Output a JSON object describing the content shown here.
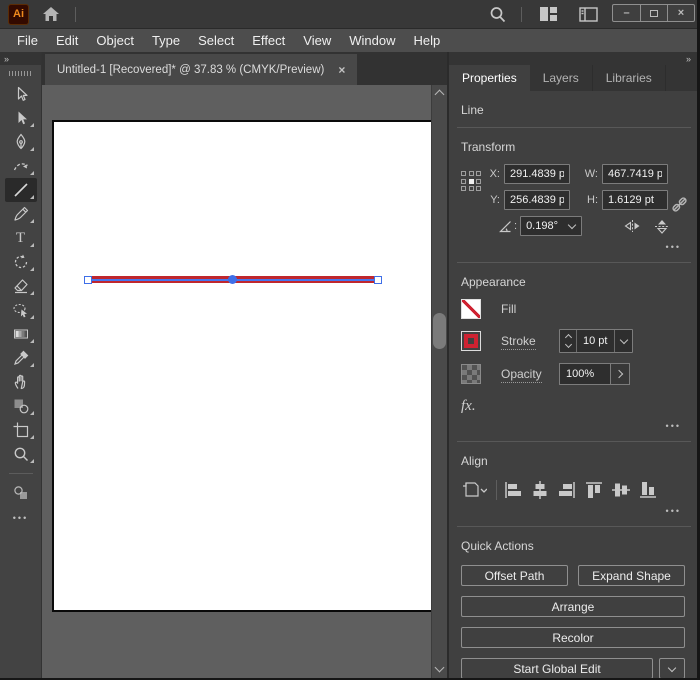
{
  "titlebar": {
    "logo": "Ai",
    "controls": {
      "minimize": "–",
      "close": "×"
    }
  },
  "menubar": {
    "items": [
      "File",
      "Edit",
      "Object",
      "Type",
      "Select",
      "Effect",
      "View",
      "Window",
      "Help"
    ]
  },
  "document_tab": {
    "title": "Untitled-1 [Recovered]* @ 37.83 % (CMYK/Preview)",
    "close_glyph": "×"
  },
  "glyphs": {
    "collapse": "»",
    "more": "•••"
  },
  "toolbar": {
    "tools": [
      "selection",
      "direct-selection",
      "pen",
      "curvature",
      "line-segment",
      "paintbrush",
      "type",
      "rotate",
      "eraser",
      "shape-builder",
      "gradient",
      "eyedropper",
      "hand",
      "shapes",
      "artboard",
      "zoom",
      "fill-stroke-proxy",
      "edit-toolbar"
    ],
    "selected_tool": "line-segment",
    "type_tool_glyph": "T"
  },
  "properties_panel": {
    "tabs": {
      "properties": "Properties",
      "layers": "Layers",
      "libraries": "Libraries"
    },
    "active_tab": "Properties",
    "selection_type": "Line",
    "transform": {
      "heading": "Transform",
      "x_label": "X:",
      "x_value": "291.4839 p",
      "y_label": "Y:",
      "y_value": "256.4839 p",
      "w_label": "W:",
      "w_value": "467.7419 p",
      "h_label": "H:",
      "h_value": "1.6129 pt",
      "angle_value": "0.198°"
    },
    "appearance": {
      "heading": "Appearance",
      "fill_label": "Fill",
      "stroke_label": "Stroke",
      "stroke_weight": "10 pt",
      "opacity_label": "Opacity",
      "opacity_value": "100%",
      "fx_label": "fx."
    },
    "align": {
      "heading": "Align"
    },
    "quick_actions": {
      "heading": "Quick Actions",
      "offset_path": "Offset Path",
      "expand_shape": "Expand Shape",
      "arrange": "Arrange",
      "recolor": "Recolor",
      "start_global_edit": "Start Global Edit"
    }
  },
  "colors": {
    "stroke_red": "#c0272e",
    "selection_blue": "#3f6fe8",
    "panel_bg": "#404040",
    "pasteboard": "#5f5f5f"
  }
}
